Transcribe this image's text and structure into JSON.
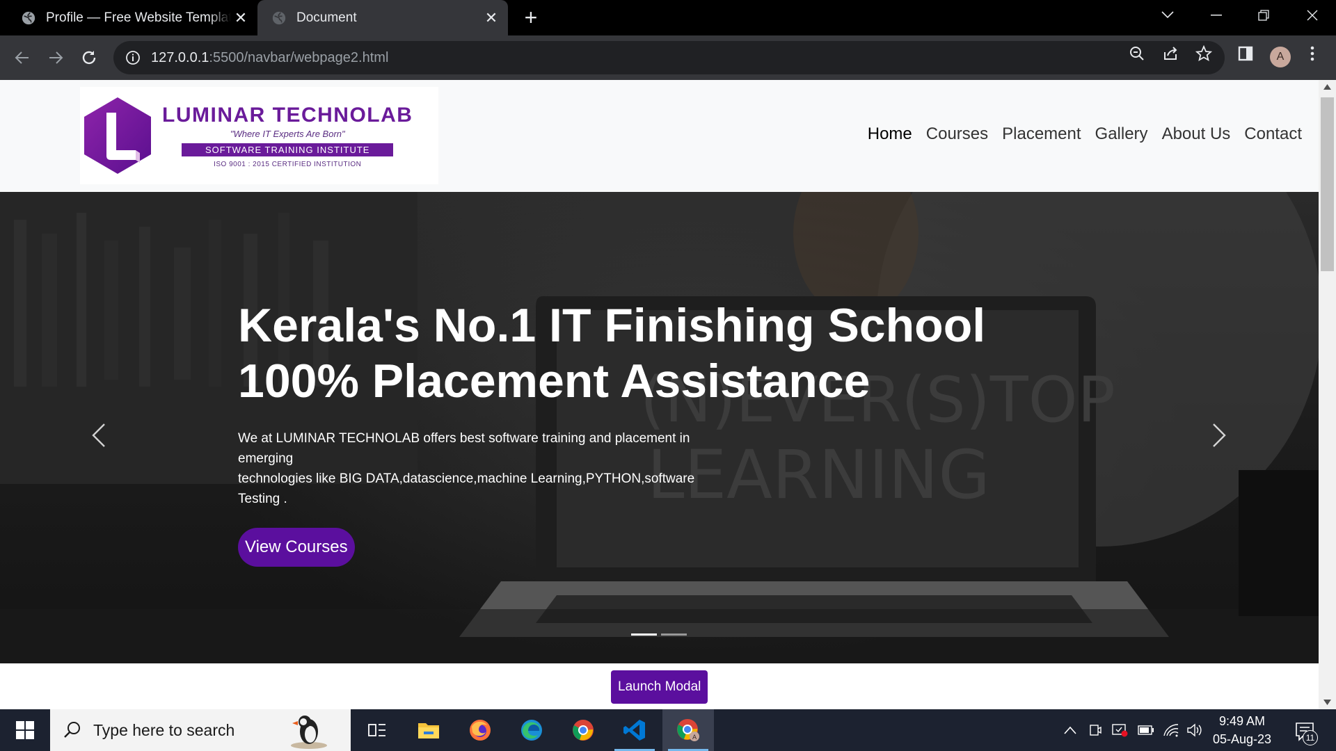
{
  "browser": {
    "tabs": [
      {
        "title": "Profile — Free Website Template",
        "active": false
      },
      {
        "title": "Document",
        "active": true
      }
    ],
    "address": {
      "host": "127.0.0.1",
      "path": ":5500/navbar/webpage2.html"
    },
    "profile_initial": "A"
  },
  "site": {
    "logo": {
      "name": "LUMINAR TECHNOLAB",
      "tagline": "\"Where IT Experts Are Born\"",
      "band": "SOFTWARE TRAINING INSTITUTE",
      "iso": "ISO 9001 : 2015 CERTIFIED INSTITUTION",
      "colors": {
        "primary": "#6a1b9a"
      }
    },
    "nav": [
      {
        "label": "Home",
        "active": true
      },
      {
        "label": "Courses"
      },
      {
        "label": "Placement"
      },
      {
        "label": "Gallery"
      },
      {
        "label": "About Us"
      },
      {
        "label": "Contact"
      }
    ],
    "hero": {
      "title_line1": "Kerala's No.1 IT Finishing School",
      "title_line2": "100% Placement Assistance",
      "desc_line1": "We at LUMINAR TECHNOLAB offers best software training and placement in",
      "desc_line2": "emerging",
      "desc_line3": "technologies like BIG DATA,datascience,machine Learning,PYTHON,software",
      "desc_line4": "Testing .",
      "button": "View Courses",
      "slide_count": 2,
      "active_slide": 1
    },
    "launch_button": "Launch Modal",
    "accent_color": "#5b0f9e"
  },
  "taskbar": {
    "search_placeholder": "Type here to search",
    "time": "9:49 AM",
    "date": "05-Aug-23",
    "notification_count": "11",
    "apps": [
      "task-view-icon",
      "file-explorer-icon",
      "firefox-icon",
      "edge-icon",
      "chrome-icon",
      "vscode-icon",
      "chrome-profile-icon"
    ]
  }
}
